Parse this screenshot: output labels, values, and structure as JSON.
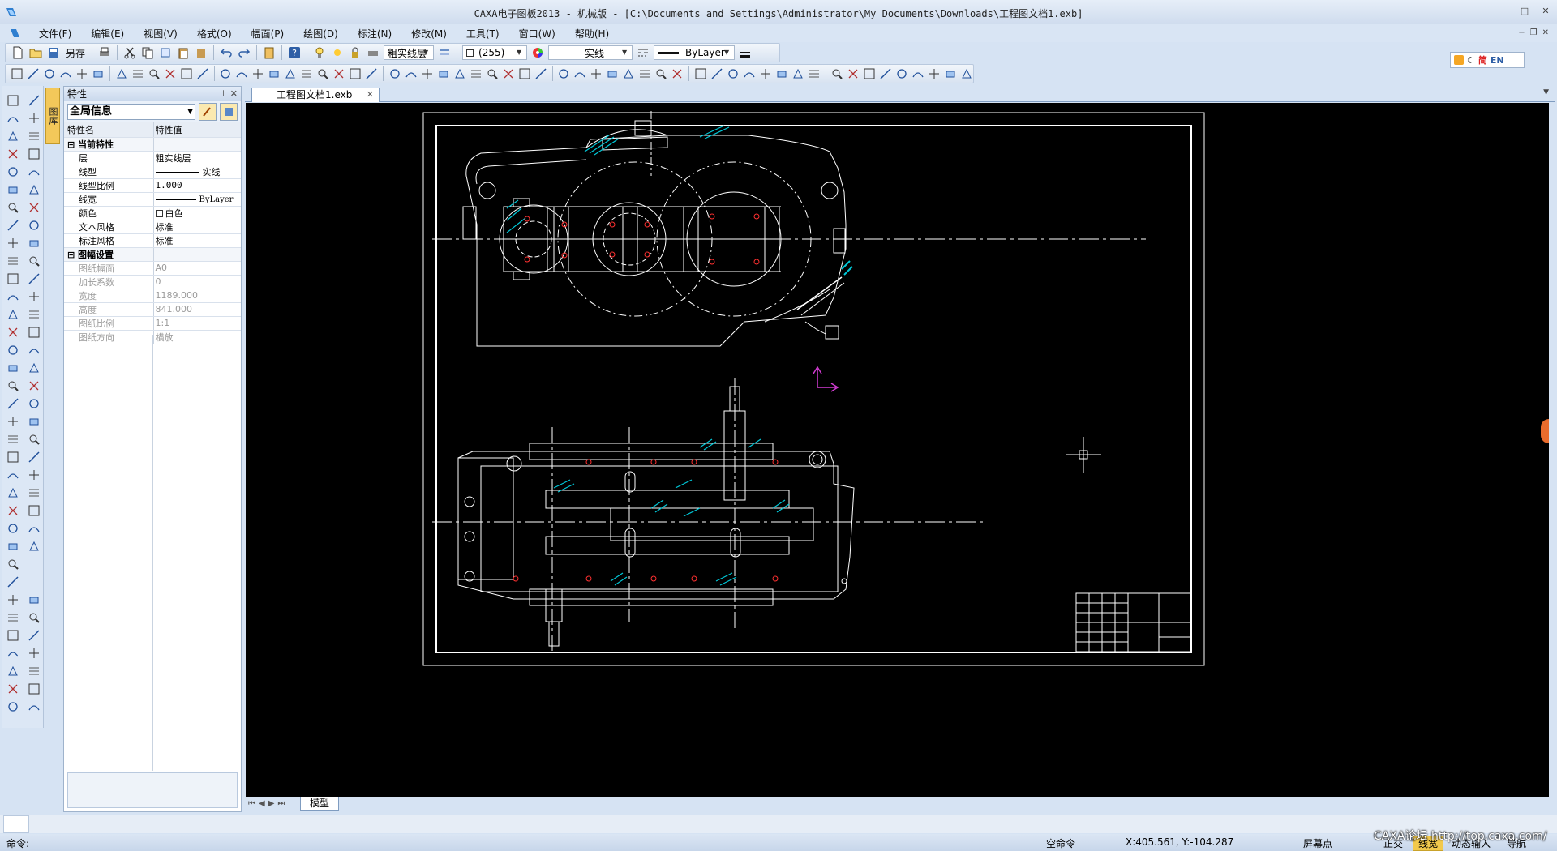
{
  "window": {
    "title": "CAXA电子图板2013 - 机械版 - [C:\\Documents and Settings\\Administrator\\My Documents\\Downloads\\工程图文档1.exb]"
  },
  "menu": [
    "文件(F)",
    "编辑(E)",
    "视图(V)",
    "格式(O)",
    "幅面(P)",
    "绘图(D)",
    "标注(N)",
    "修改(M)",
    "工具(T)",
    "窗口(W)",
    "帮助(H)"
  ],
  "toolbar": {
    "save_as_label": "另存",
    "layer_value": "粗实线层",
    "color_value": "(255)",
    "linetype_value": "实线",
    "linewidth_value": "ByLayer"
  },
  "ime": {
    "lang_label": "简",
    "mode_label": "EN"
  },
  "side_tab": {
    "label": "图库"
  },
  "properties": {
    "title": "特性",
    "scope": "全局信息",
    "col_name": "特性名",
    "col_value": "特性值",
    "sections": [
      {
        "label": "当前特性",
        "rows": [
          {
            "name": "层",
            "value": "粗实线层"
          },
          {
            "name": "线型",
            "value": "实线"
          },
          {
            "name": "线型比例",
            "value": "1.000"
          },
          {
            "name": "线宽",
            "value": "ByLayer"
          },
          {
            "name": "颜色",
            "value": "白色"
          },
          {
            "name": "文本风格",
            "value": "标准"
          },
          {
            "name": "标注风格",
            "value": "标准"
          }
        ]
      },
      {
        "label": "图幅设置",
        "rows": [
          {
            "name": "图纸幅面",
            "value": "A0"
          },
          {
            "name": "加长系数",
            "value": "0"
          },
          {
            "name": "宽度",
            "value": "1189.000"
          },
          {
            "name": "高度",
            "value": "841.000"
          },
          {
            "name": "图纸比例",
            "value": "1:1"
          },
          {
            "name": "图纸方向",
            "value": "横放"
          }
        ]
      }
    ]
  },
  "document": {
    "tab_label": "工程图文档1.exb",
    "model_tab": "模型"
  },
  "command": {
    "prompt": "命令:"
  },
  "status": {
    "current_command": "空命令",
    "coords": "X:405.561, Y:-104.287",
    "snap_mode": "屏幕点",
    "toggles": [
      "正交",
      "线宽",
      "动态输入",
      "导航"
    ],
    "active_toggle": "线宽"
  },
  "watermark": "CAXA论坛 http://top.caxa.com/",
  "colors": {
    "canvas": "#000000",
    "drawing_lines": "#ffffff",
    "hatch": "#00c8d8",
    "center_marks": "#ff3030",
    "ucs": "#d23cd2",
    "accent": "#f2c94c"
  }
}
